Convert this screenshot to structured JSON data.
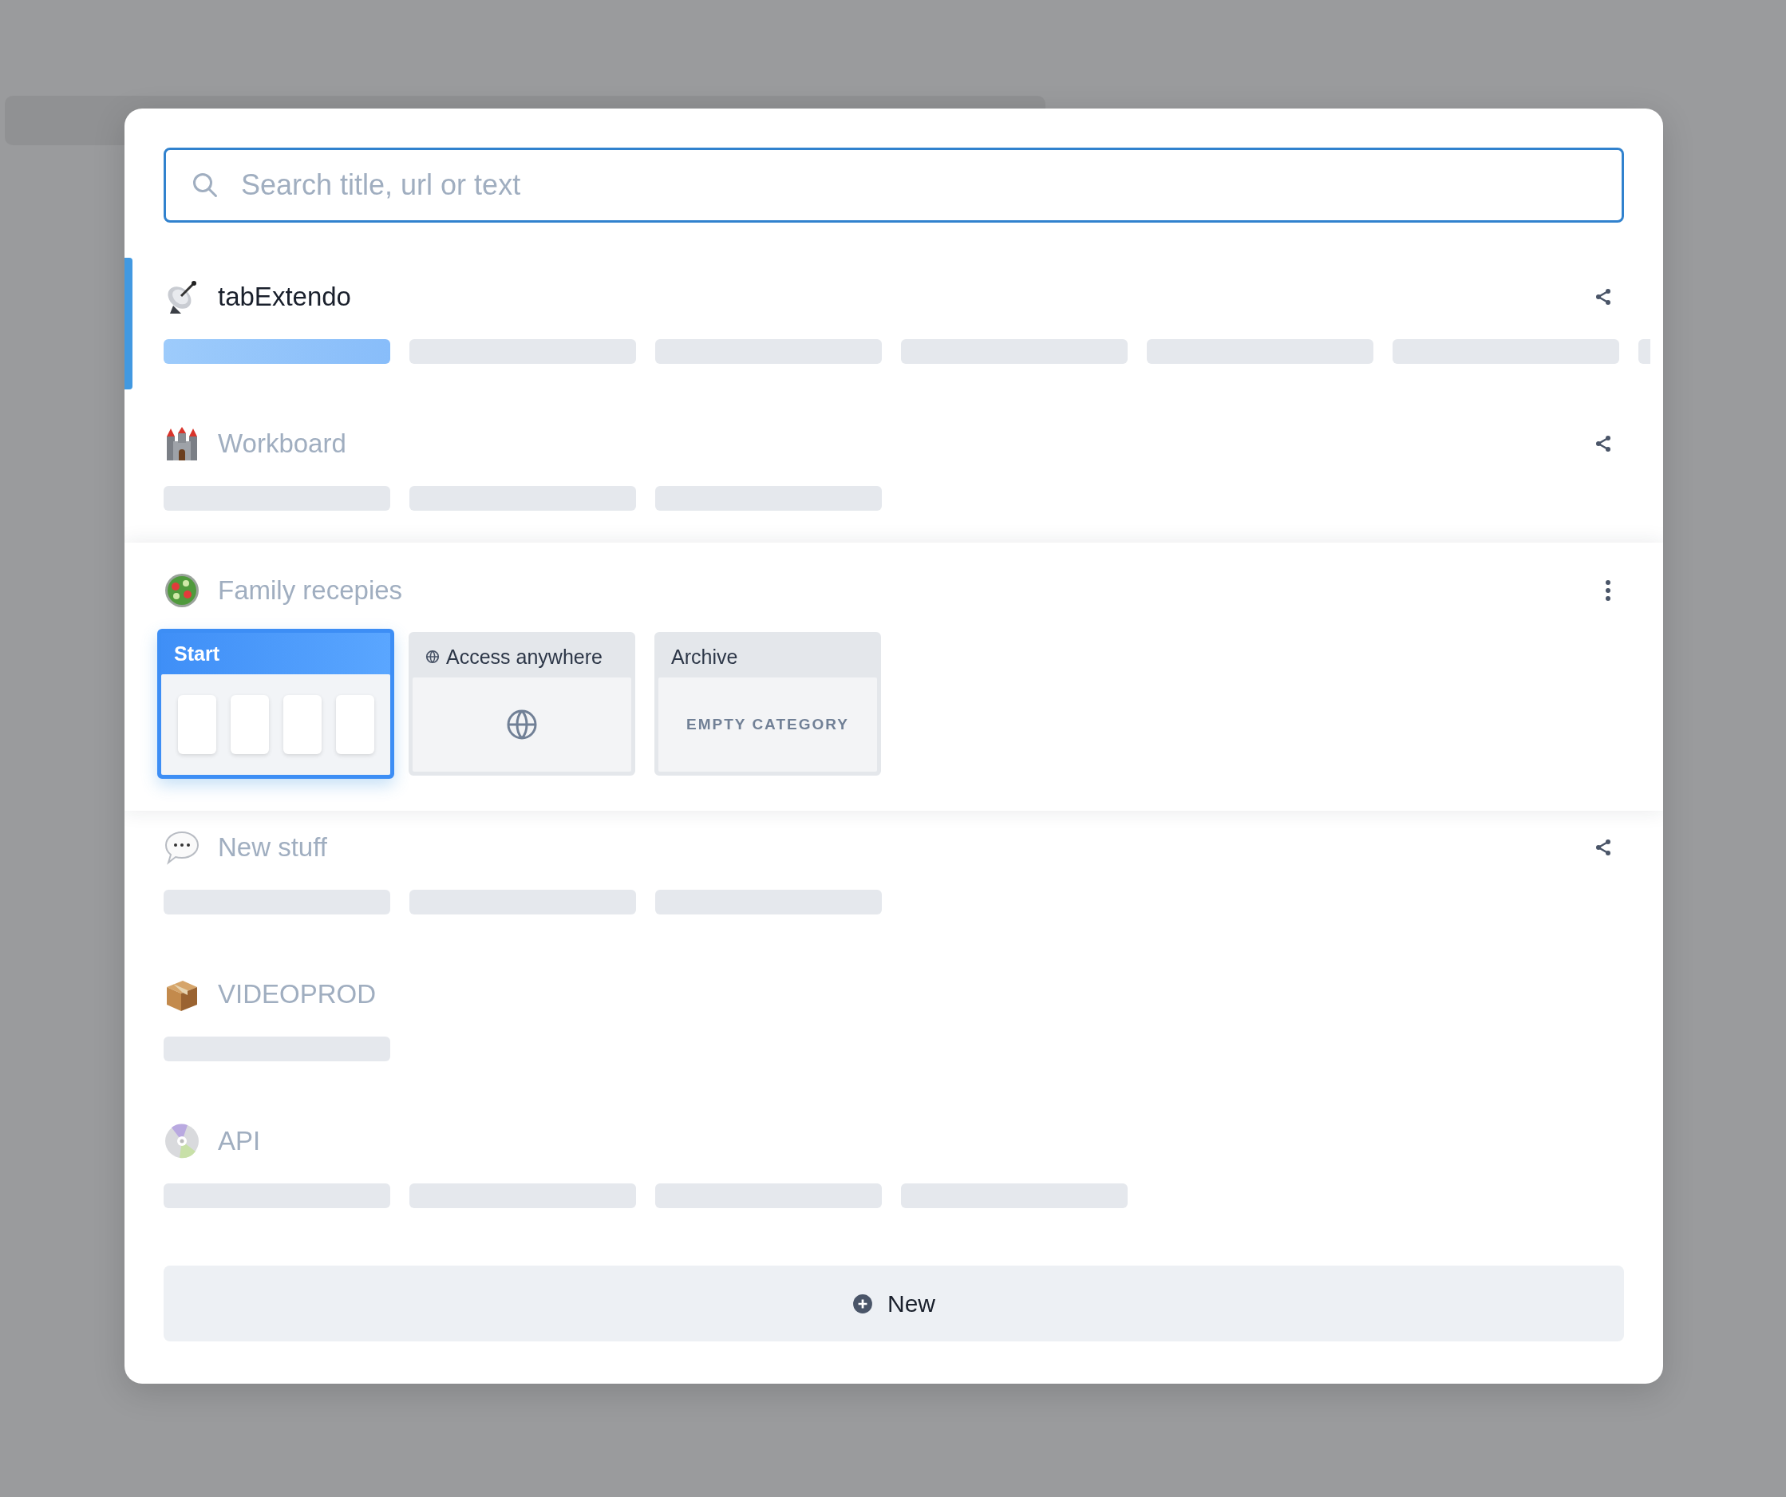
{
  "search": {
    "placeholder": "Search title, url or text"
  },
  "spaces": [
    {
      "title": "tabExtendo",
      "selected": true,
      "expanded": false,
      "shared": true,
      "categories": [
        {
          "selected": true
        },
        {
          "selected": false
        },
        {
          "selected": false
        },
        {
          "selected": false
        },
        {
          "selected": false
        },
        {
          "selected": false
        },
        {
          "selected": false
        }
      ]
    },
    {
      "title": "Workboard",
      "selected": false,
      "expanded": false,
      "shared": true,
      "categories": [
        {
          "selected": false
        },
        {
          "selected": false
        },
        {
          "selected": false
        }
      ]
    },
    {
      "title": "Family recepies",
      "selected": false,
      "expanded": true,
      "categories": [
        {
          "title": "Start",
          "kind": "tabs",
          "selected": true,
          "shared": false,
          "tabs": [
            {
              "kind": "tab"
            },
            {
              "kind": "tab"
            },
            {
              "kind": "tab"
            },
            {
              "kind": "tab"
            }
          ]
        },
        {
          "title": "Access anywhere",
          "kind": "shared",
          "selected": false,
          "shared": true
        },
        {
          "title": "Archive",
          "kind": "empty",
          "selected": false,
          "shared": false,
          "note": "EMPTY CATEGORY"
        }
      ]
    },
    {
      "title": "New stuff",
      "selected": false,
      "expanded": false,
      "shared": true,
      "categories": [
        {
          "selected": false
        },
        {
          "selected": false
        },
        {
          "selected": false
        }
      ]
    },
    {
      "title": "VIDEOPROD",
      "selected": false,
      "expanded": false,
      "shared": false,
      "categories": [
        {
          "selected": false
        }
      ]
    },
    {
      "title": "API",
      "selected": false,
      "expanded": false,
      "shared": false,
      "categories": [
        {
          "selected": false
        },
        {
          "selected": false
        },
        {
          "selected": false
        },
        {
          "selected": false
        }
      ]
    }
  ],
  "new_button": {
    "label": "New"
  }
}
